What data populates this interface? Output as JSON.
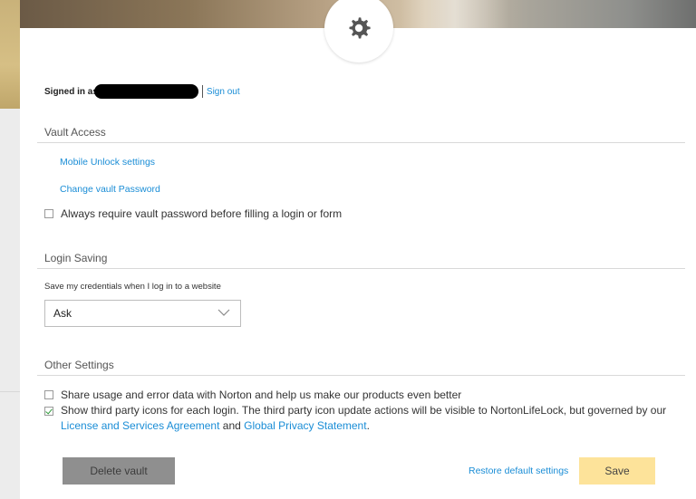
{
  "header": {
    "icon": "gear-icon"
  },
  "account": {
    "signed_in_label": "Signed in as",
    "sign_out": "Sign out"
  },
  "vault_access": {
    "title": "Vault Access",
    "mobile_unlock": "Mobile Unlock settings",
    "change_password": "Change vault Password",
    "always_require": "Always require vault password before filling a login or form",
    "always_require_checked": false
  },
  "login_saving": {
    "title": "Login Saving",
    "save_label": "Save my credentials when I log in to a website",
    "selected": "Ask"
  },
  "other_settings": {
    "title": "Other Settings",
    "share_usage": "Share usage and error data with Norton and help us make our products even better",
    "share_usage_checked": false,
    "third_party_text": "Show third party icons for each login. The third party icon update actions will be visible to NortonLifeLock, but governed by our",
    "license_link": "License and Services Agreement",
    "and_text": "and",
    "privacy_link": "Global Privacy Statement",
    "period": ".",
    "third_party_checked": true
  },
  "footer": {
    "delete_vault": "Delete vault",
    "restore_defaults": "Restore default settings",
    "save": "Save"
  },
  "colors": {
    "link": "#1a8dd6",
    "save_button": "#fde39a",
    "delete_button": "#8f8f8f",
    "check": "#2e9b3a"
  }
}
